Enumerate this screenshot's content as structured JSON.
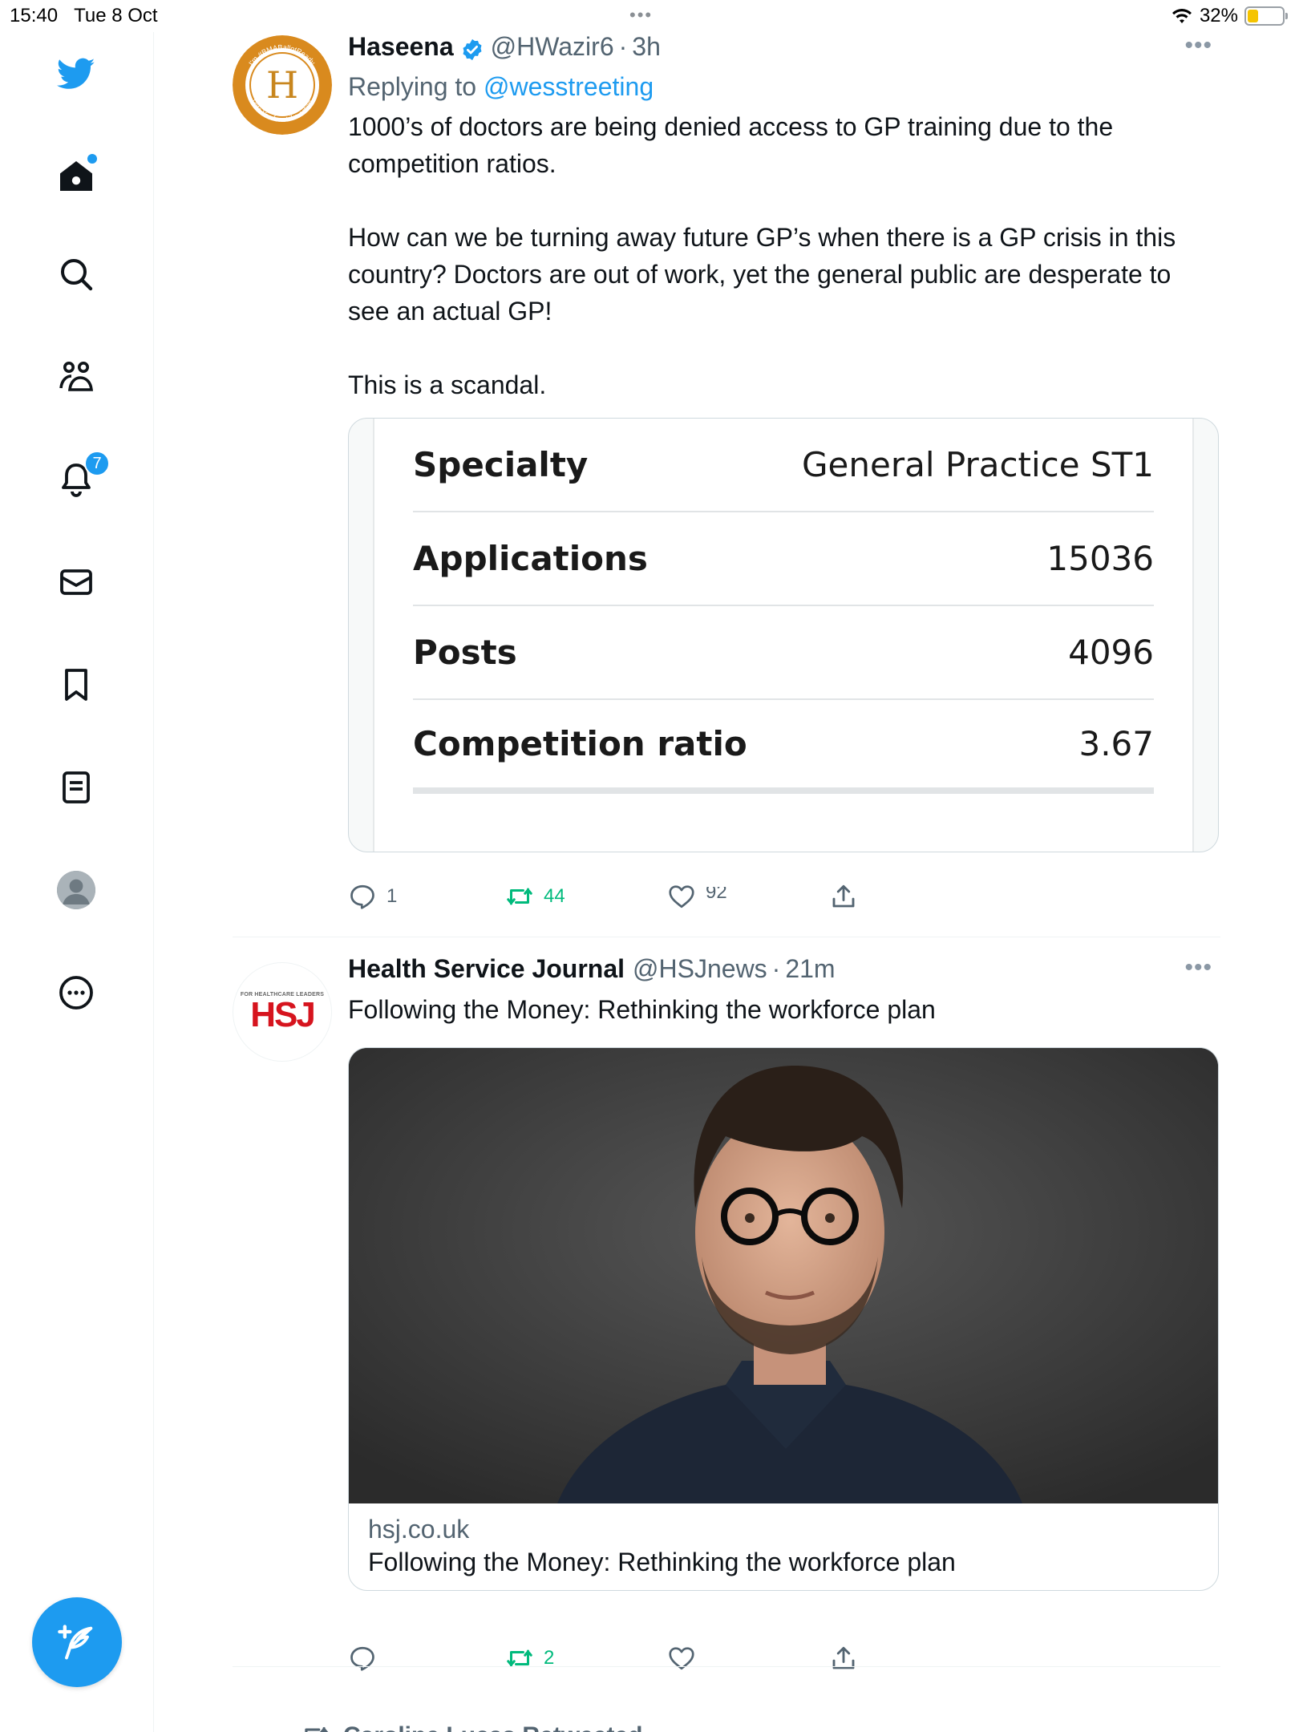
{
  "status_bar": {
    "time": "15:40",
    "date": "Tue 8 Oct",
    "battery": "32%",
    "battery_level": 0.32
  },
  "sidebar": {
    "notifications_count": "7",
    "items": [
      {
        "name": "home",
        "icon": "home-icon"
      },
      {
        "name": "explore",
        "icon": "search-icon"
      },
      {
        "name": "communities",
        "icon": "communities-icon"
      },
      {
        "name": "notifications",
        "icon": "bell-icon"
      },
      {
        "name": "messages",
        "icon": "mail-icon"
      },
      {
        "name": "bookmarks",
        "icon": "bookmark-icon"
      },
      {
        "name": "lists",
        "icon": "list-icon"
      },
      {
        "name": "profile",
        "icon": "avatar"
      },
      {
        "name": "more",
        "icon": "more-circle-icon"
      }
    ]
  },
  "tweets": [
    {
      "name": "Haseena",
      "handle": "@HWazir6",
      "sep": "·",
      "time": "3h",
      "replying_prefix": "Replying to",
      "replying_to": "@wesstreeting",
      "text": [
        "1000’s of doctors are being denied access to GP training due to the competition ratios.",
        "How can we be turning away future GP’s when there is a GP crisis in this country? Doctors are out of work, yet the general public are desperate to see an actual GP!",
        "This is a scandal."
      ],
      "table": [
        {
          "key": "Specialty",
          "value": "General Practice ST1"
        },
        {
          "key": "Applications",
          "value": "15036"
        },
        {
          "key": "Posts",
          "value": "4096"
        },
        {
          "key": "Competition ratio",
          "value": "3.67"
        }
      ],
      "replies": "1",
      "retweets": "44",
      "likes": "92"
    },
    {
      "name": "Health Service Journal",
      "handle": "@HSJnews",
      "sep": "·",
      "time": "21m",
      "text": "Following the Money: Rethinking the workforce plan",
      "avatar_small": "FOR HEALTHCARE LEADERS",
      "avatar_logo": "HSJ",
      "card_domain": "hsj.co.uk",
      "card_title": "Following the Money: Rethinking the workforce plan",
      "replies": "",
      "retweets": "2",
      "likes": ""
    }
  ],
  "retweeted_by": "Caroline Lucas Retweeted",
  "colors": {
    "accent": "#1d9bf0",
    "retweet_green": "#00ba7c",
    "muted": "#536471",
    "hsj_red": "#d6141e",
    "avatar_orange": "#d98a1e"
  }
}
